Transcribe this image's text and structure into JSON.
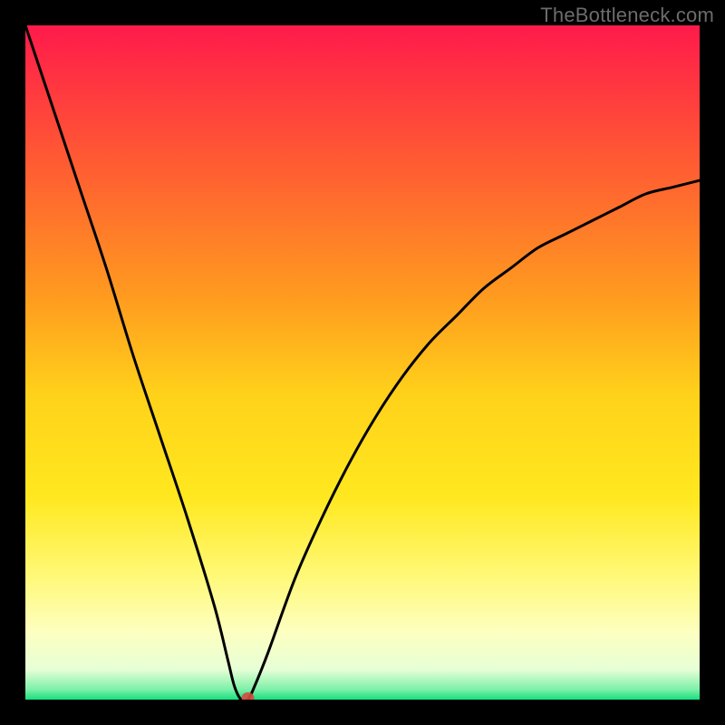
{
  "watermark": "TheBottleneck.com",
  "chart_data": {
    "type": "line",
    "title": "",
    "xlabel": "",
    "ylabel": "",
    "xlim": [
      0,
      100
    ],
    "ylim": [
      0,
      100
    ],
    "x": [
      0,
      4,
      8,
      12,
      16,
      20,
      24,
      28,
      30,
      31,
      32,
      33,
      34,
      36,
      40,
      44,
      48,
      52,
      56,
      60,
      64,
      68,
      72,
      76,
      80,
      84,
      88,
      92,
      96,
      100
    ],
    "values": [
      100,
      88,
      76,
      64,
      51,
      39,
      27,
      14,
      6,
      2,
      0,
      0,
      2,
      7,
      18,
      27,
      35,
      42,
      48,
      53,
      57,
      61,
      64,
      67,
      69,
      71,
      73,
      75,
      76,
      77
    ],
    "marker": {
      "x": 33,
      "y": 0,
      "color": "#d64a3e",
      "radius": 7
    },
    "gradient_bands": [
      {
        "stop": 0.0,
        "color": "#ff1a4b"
      },
      {
        "stop": 0.2,
        "color": "#ff5a33"
      },
      {
        "stop": 0.4,
        "color": "#ff9a1f"
      },
      {
        "stop": 0.55,
        "color": "#ffd21a"
      },
      {
        "stop": 0.7,
        "color": "#ffe81f"
      },
      {
        "stop": 0.82,
        "color": "#fff97a"
      },
      {
        "stop": 0.9,
        "color": "#fdffc0"
      },
      {
        "stop": 0.955,
        "color": "#e7ffd6"
      },
      {
        "stop": 0.985,
        "color": "#7df0a8"
      },
      {
        "stop": 1.0,
        "color": "#16e07e"
      }
    ],
    "curve_color": "#000000",
    "curve_stroke": 3
  }
}
